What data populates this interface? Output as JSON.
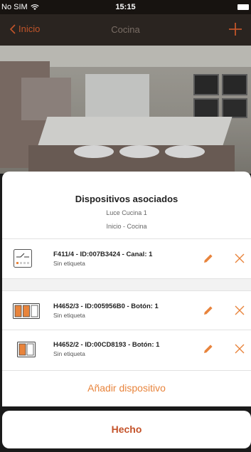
{
  "status_bar": {
    "carrier": "No SIM",
    "time": "15:15"
  },
  "nav": {
    "back_label": "Inicio",
    "title": "Cocina"
  },
  "sheet": {
    "title": "Dispositivos asociados",
    "subtitle": "Luce Cucina 1",
    "location": "Inicio - Cocina"
  },
  "devices": [
    {
      "name": "F411/4 - ID:007B3424 - Canal: 1",
      "tag": "Sin etiqueta",
      "icon": "switch-module-icon"
    },
    {
      "name": "H4652/3 - ID:005956B0 - Botón: 1",
      "tag": "Sin etiqueta",
      "icon": "triple-button-icon"
    },
    {
      "name": "H4652/2 - ID:00CD8193 - Botón: 1",
      "tag": "Sin etiqueta",
      "icon": "double-button-icon"
    }
  ],
  "actions": {
    "add_device": "Añadir dispositivo",
    "done": "Hecho"
  },
  "colors": {
    "accent": "#e8843c",
    "accent_dark": "#c4532a",
    "nav_bg": "#2a2420"
  }
}
